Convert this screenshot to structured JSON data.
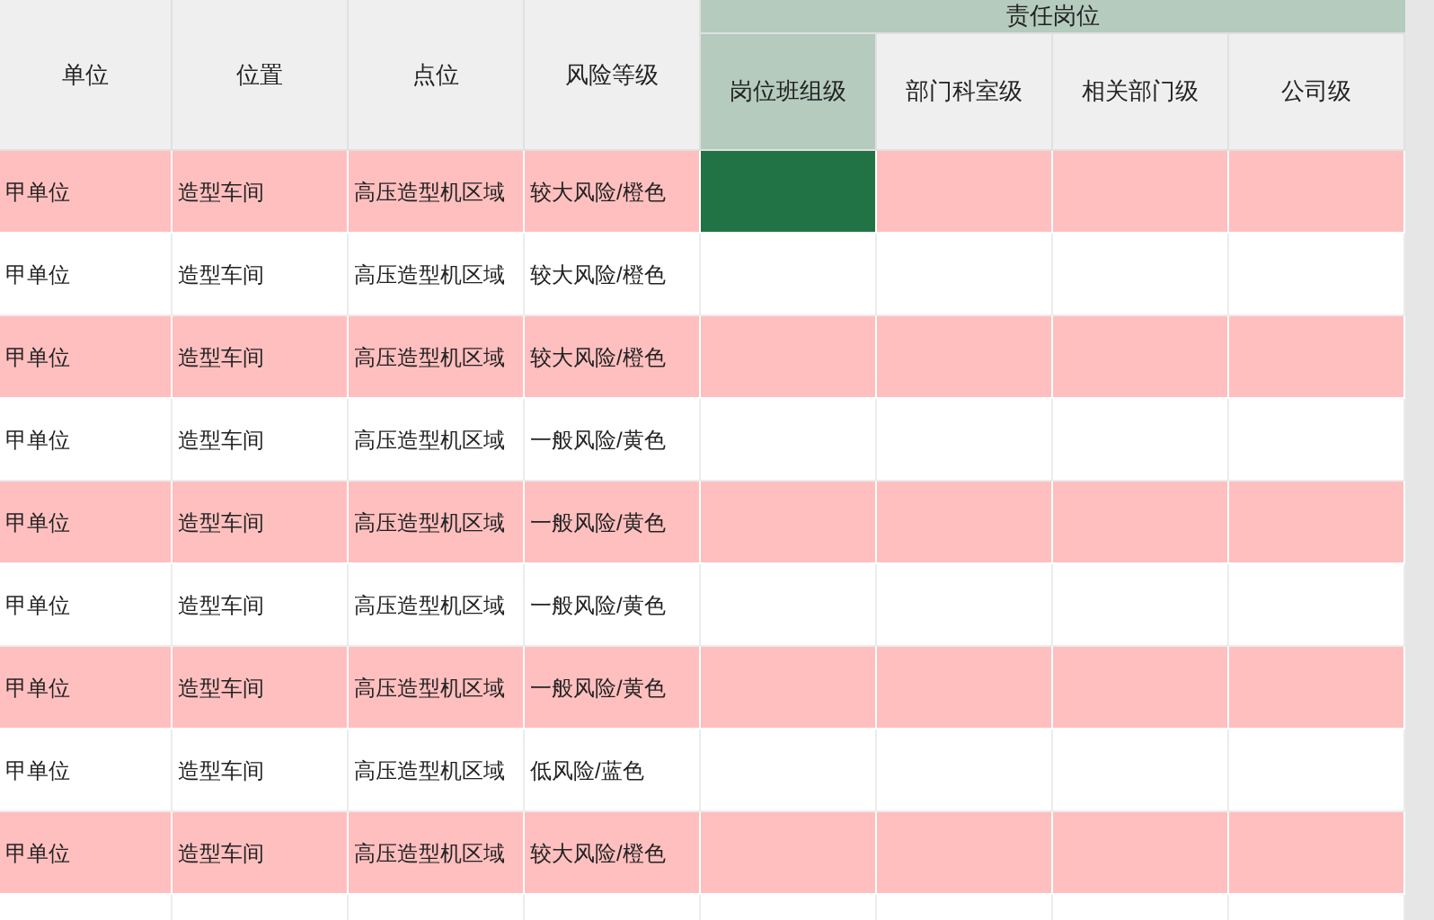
{
  "columns": [
    {
      "label": "单位"
    },
    {
      "label": "位置"
    },
    {
      "label": "点位"
    },
    {
      "label": "风险等级"
    }
  ],
  "group_header": {
    "label": "责任岗位"
  },
  "responsibility_columns": [
    {
      "label": "岗位班组级",
      "selected": true
    },
    {
      "label": "部门科室级",
      "selected": false
    },
    {
      "label": "相关部门级",
      "selected": false
    },
    {
      "label": "公司级",
      "selected": false
    }
  ],
  "rows": [
    {
      "unit": "甲单位",
      "location": "造型车间",
      "point": "高压造型机区域",
      "risk": "较大风险/橙色",
      "highlighted": true,
      "slots": [
        {
          "selected": true
        },
        {
          "selected": false
        },
        {
          "selected": false
        },
        {
          "selected": false
        }
      ]
    },
    {
      "unit": "甲单位",
      "location": "造型车间",
      "point": "高压造型机区域",
      "risk": "较大风险/橙色",
      "highlighted": false,
      "slots": [
        {
          "selected": false
        },
        {
          "selected": false
        },
        {
          "selected": false
        },
        {
          "selected": false
        }
      ]
    },
    {
      "unit": "甲单位",
      "location": "造型车间",
      "point": "高压造型机区域",
      "risk": "较大风险/橙色",
      "highlighted": true,
      "slots": [
        {
          "selected": false
        },
        {
          "selected": false
        },
        {
          "selected": false
        },
        {
          "selected": false
        }
      ]
    },
    {
      "unit": "甲单位",
      "location": "造型车间",
      "point": "高压造型机区域",
      "risk": "一般风险/黄色",
      "highlighted": false,
      "slots": [
        {
          "selected": false
        },
        {
          "selected": false
        },
        {
          "selected": false
        },
        {
          "selected": false
        }
      ]
    },
    {
      "unit": "甲单位",
      "location": "造型车间",
      "point": "高压造型机区域",
      "risk": "一般风险/黄色",
      "highlighted": true,
      "slots": [
        {
          "selected": false
        },
        {
          "selected": false
        },
        {
          "selected": false
        },
        {
          "selected": false
        }
      ]
    },
    {
      "unit": "甲单位",
      "location": "造型车间",
      "point": "高压造型机区域",
      "risk": "一般风险/黄色",
      "highlighted": false,
      "slots": [
        {
          "selected": false
        },
        {
          "selected": false
        },
        {
          "selected": false
        },
        {
          "selected": false
        }
      ]
    },
    {
      "unit": "甲单位",
      "location": "造型车间",
      "point": "高压造型机区域",
      "risk": "一般风险/黄色",
      "highlighted": true,
      "slots": [
        {
          "selected": false
        },
        {
          "selected": false
        },
        {
          "selected": false
        },
        {
          "selected": false
        }
      ]
    },
    {
      "unit": "甲单位",
      "location": "造型车间",
      "point": "高压造型机区域",
      "risk": "低风险/蓝色",
      "highlighted": false,
      "slots": [
        {
          "selected": false
        },
        {
          "selected": false
        },
        {
          "selected": false
        },
        {
          "selected": false
        }
      ]
    },
    {
      "unit": "甲单位",
      "location": "造型车间",
      "point": "高压造型机区域",
      "risk": "较大风险/橙色",
      "highlighted": true,
      "slots": [
        {
          "selected": false
        },
        {
          "selected": false
        },
        {
          "selected": false
        },
        {
          "selected": false
        }
      ]
    }
  ]
}
